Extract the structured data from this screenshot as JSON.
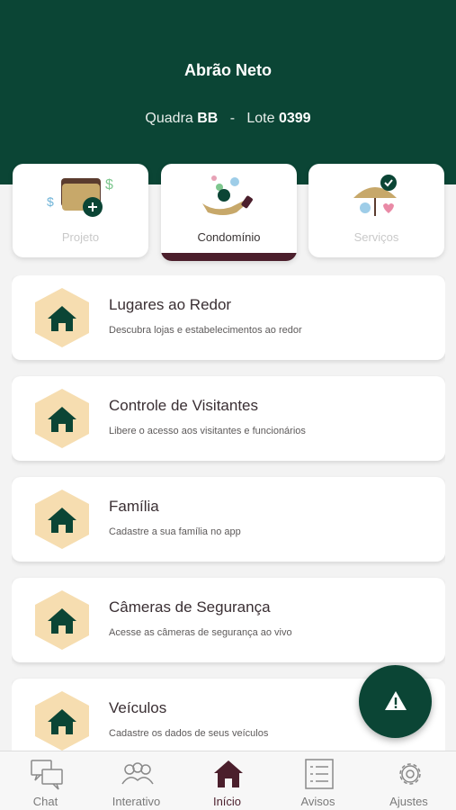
{
  "header": {
    "user_name": "Abrão Neto",
    "quadra_label": "Quadra",
    "quadra_value": "BB",
    "separator": "-",
    "lote_label": "Lote",
    "lote_value": "0399"
  },
  "tabs": [
    {
      "label": "Projeto",
      "icon": "wallet-icon",
      "active": false
    },
    {
      "label": "Condomínio",
      "icon": "hand-coins-icon",
      "active": true
    },
    {
      "label": "Serviços",
      "icon": "umbrella-icon",
      "active": false
    }
  ],
  "menu": [
    {
      "title": "Lugares ao Redor",
      "description": "Descubra lojas e estabelecimentos ao redor",
      "icon": "home-icon"
    },
    {
      "title": "Controle de Visitantes",
      "description": "Libere o acesso aos visitantes e funcionários",
      "icon": "home-icon"
    },
    {
      "title": "Família",
      "description": "Cadastre a sua família no app",
      "icon": "home-icon"
    },
    {
      "title": "Câmeras de Segurança",
      "description": "Acesse as câmeras de segurança ao vivo",
      "icon": "home-icon"
    },
    {
      "title": "Veículos",
      "description": "Cadastre os dados de seus veículos",
      "icon": "home-icon"
    }
  ],
  "fab": {
    "icon": "warning-icon"
  },
  "bottom_nav": [
    {
      "label": "Chat",
      "icon": "chat-icon",
      "active": false
    },
    {
      "label": "Interativo",
      "icon": "people-icon",
      "active": false
    },
    {
      "label": "Início",
      "icon": "home-icon",
      "active": true
    },
    {
      "label": "Avisos",
      "icon": "list-icon",
      "active": false
    },
    {
      "label": "Ajustes",
      "icon": "gear-icon",
      "active": false
    }
  ],
  "colors": {
    "primary_green": "#0b4535",
    "accent_wine": "#4b1f2c",
    "hex_beige": "#f6ddb0",
    "background": "#f3f3f3"
  }
}
